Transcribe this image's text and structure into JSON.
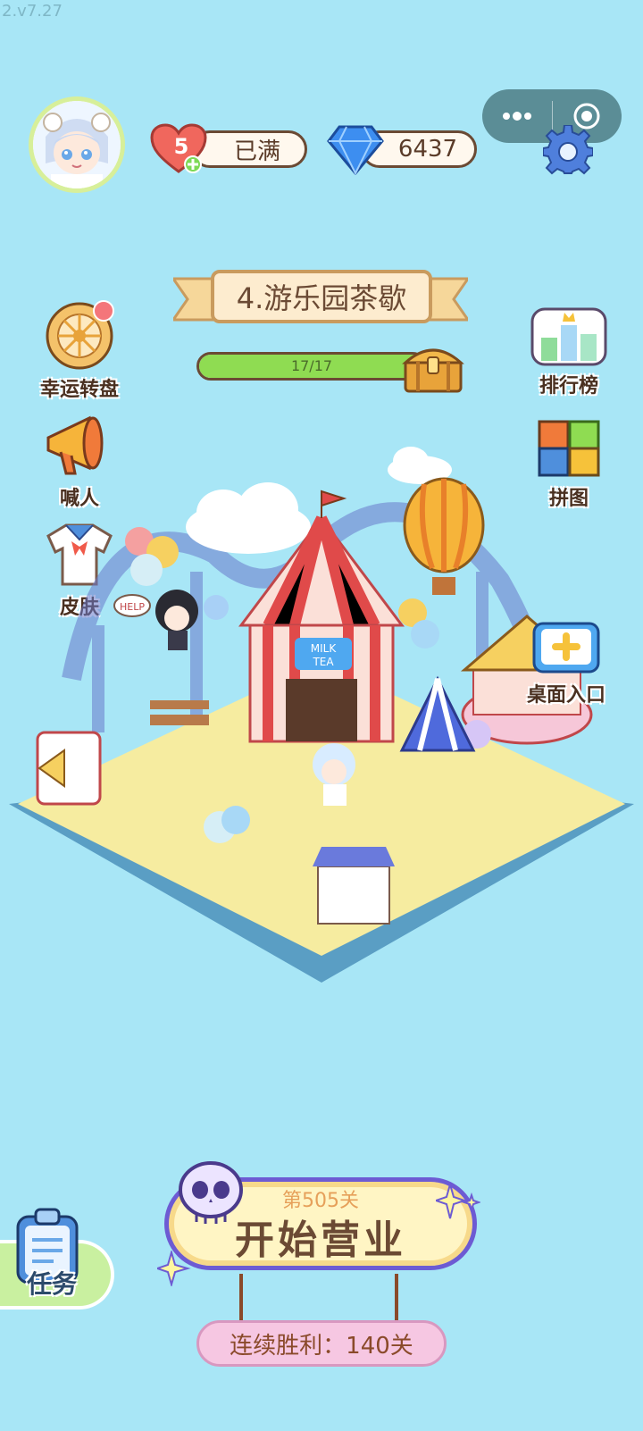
{
  "version": "2.v7.27",
  "player": {
    "hearts": "5",
    "hearts_status": "已满",
    "gems": "6437"
  },
  "level": {
    "title": "4.游乐园茶歇",
    "progress_text": "17/17",
    "progress_fraction": 1.0
  },
  "menu": {
    "wheel": "幸运转盘",
    "shout": "喊人",
    "skin": "皮肤",
    "rank": "排行榜",
    "puzzle": "拼图",
    "desktop": "桌面入口",
    "task": "任务"
  },
  "scene": {
    "help_text": "HELP",
    "shop_sign": [
      "MILK",
      "TEA"
    ]
  },
  "start": {
    "level_label": "第505关",
    "button_label": "开始营业",
    "streak": "连续胜利：140关"
  },
  "colors": {
    "background": "#a8e6f6",
    "accent": "#6d5bd3",
    "progress": "#8fdc52"
  }
}
